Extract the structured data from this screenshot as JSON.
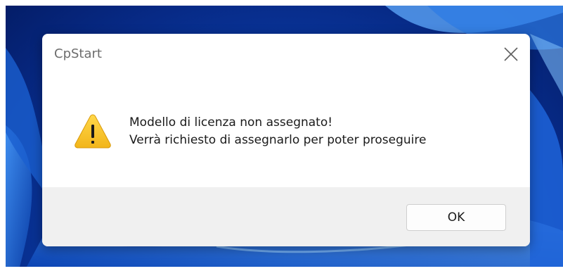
{
  "window": {
    "title": "CpStart"
  },
  "dialog": {
    "icon": "warning-icon",
    "message_line1": "Modello di licenza non assegnato!",
    "message_line2": "Verrà richiesto di assegnarlo per poter proseguire",
    "ok_label": "OK"
  },
  "colors": {
    "warning_fill": "#f7c325",
    "footer_bg": "#f0f0f0",
    "wallpaper_blue": "#0a3fae"
  }
}
